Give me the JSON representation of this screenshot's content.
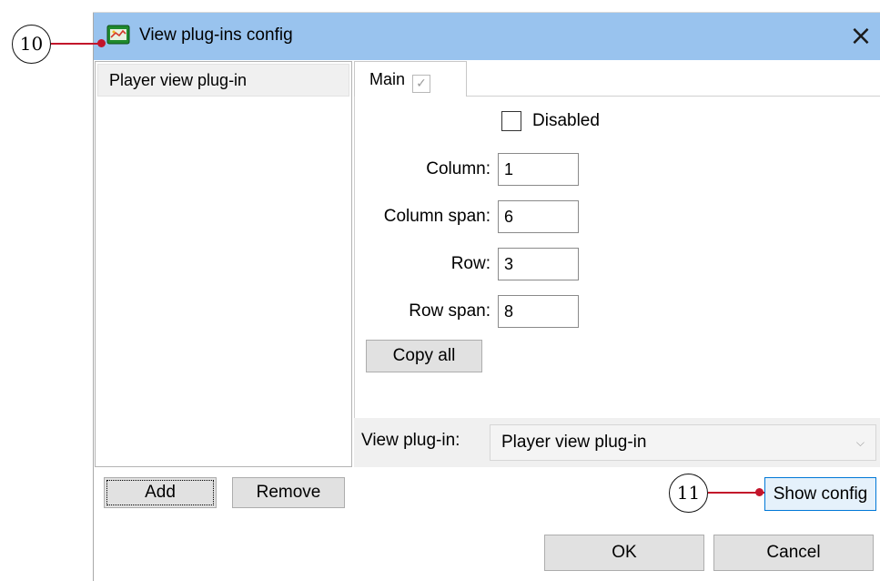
{
  "window": {
    "title": "View plug-ins config",
    "close_glyph": "×"
  },
  "callouts": [
    "10",
    "11"
  ],
  "plugins_list": {
    "items": [
      "Player view plug-in"
    ]
  },
  "tabs": [
    {
      "label": "Main",
      "checked": true,
      "check_glyph": "✓"
    }
  ],
  "main": {
    "disabled_label": "Disabled",
    "disabled_checked": false,
    "fields": [
      {
        "label": "Column:",
        "value": "1"
      },
      {
        "label": "Column span:",
        "value": "6"
      },
      {
        "label": "Row:",
        "value": "3"
      },
      {
        "label": "Row span:",
        "value": "8"
      }
    ],
    "copy_all_label": "Copy all"
  },
  "view_plugin": {
    "label": "View plug-in:",
    "selected": "Player view plug-in",
    "chevron": "⌵"
  },
  "buttons": {
    "add": "Add",
    "remove": "Remove",
    "show_config": "Show config",
    "ok": "OK",
    "cancel": "Cancel"
  },
  "colors": {
    "titlebar": "#99c3ee",
    "callout_line": "#c3152b",
    "focus_border": "#0078d7"
  }
}
